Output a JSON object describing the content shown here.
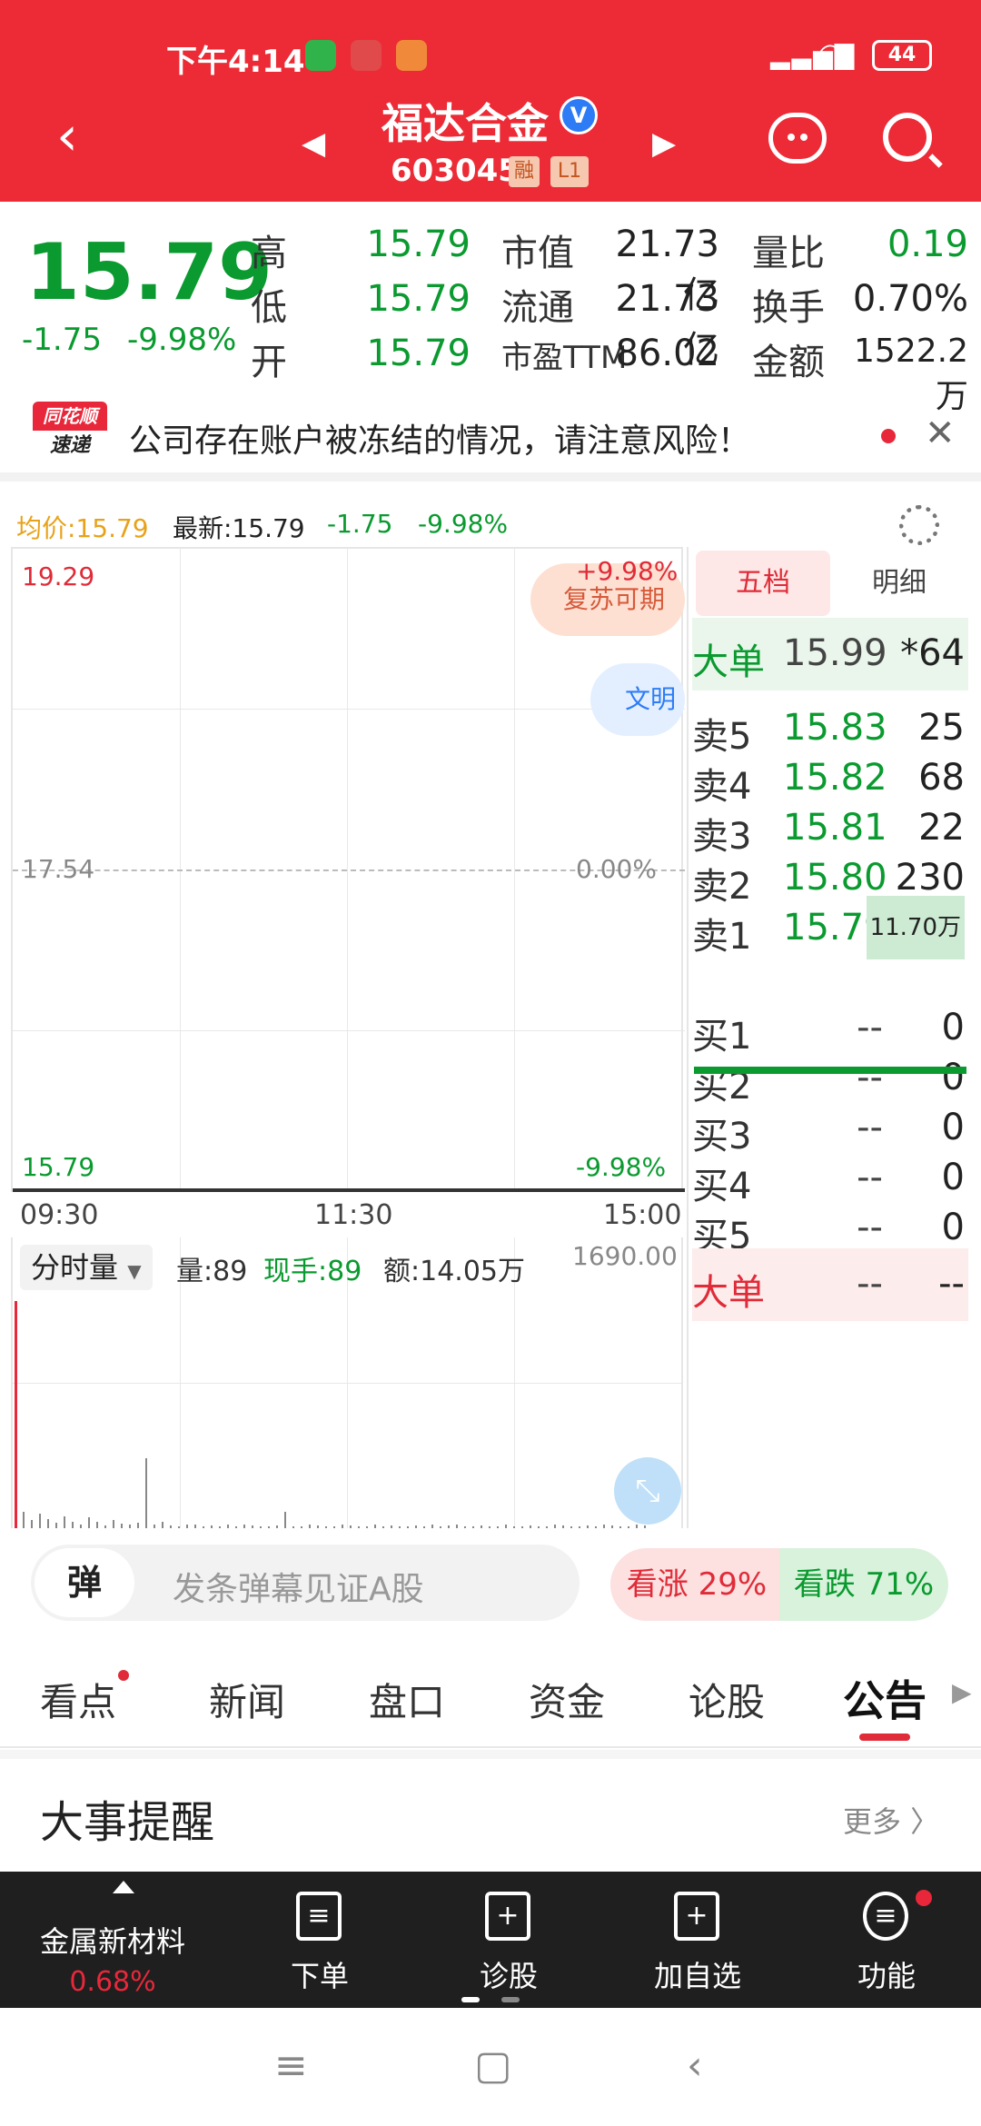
{
  "status_bar": {
    "time": "下午4:14",
    "battery": "44"
  },
  "header": {
    "stock_name": "福达合金",
    "stock_code": "603045",
    "tags": [
      "融",
      "L1"
    ]
  },
  "quote": {
    "price": "15.79",
    "change": "-1.75",
    "change_pct": "-9.98%",
    "rows": [
      {
        "l1": "高",
        "v1": "15.79",
        "l2": "市值",
        "v2": "21.73亿",
        "l3": "量比",
        "v3": "0.19"
      },
      {
        "l1": "低",
        "v1": "15.79",
        "l2": "流通",
        "v2": "21.73亿",
        "l3": "换手",
        "v3": "0.70%"
      },
      {
        "l1": "开",
        "v1": "15.79",
        "l2": "市盈TTM",
        "v2": "86.02",
        "l3": "金额",
        "v3": "1522.2万"
      }
    ]
  },
  "notice": {
    "logo_top": "同花顺",
    "logo_bottom": "速递",
    "text": "公司存在账户被冻结的情况，请注意风险！"
  },
  "chart_info": {
    "avg_price": "均价:15.79",
    "latest": "最新:15.79",
    "change": "-1.75",
    "change_pct": "-9.98%"
  },
  "intraday_chart": {
    "y_top": "19.29",
    "y_mid": "17.54",
    "y_bottom": "15.79",
    "pct_top": "+9.98%",
    "pct_mid": "0.00%",
    "pct_bottom": "-9.98%",
    "bubble_1": "复苏可期",
    "bubble_2": "文明",
    "time_labels": [
      "09:30",
      "11:30",
      "15:00"
    ]
  },
  "volume_panel": {
    "selector": "分时量",
    "vol": "量:89",
    "hand": "现手:89",
    "amount": "额:14.05万",
    "max": "1690.00",
    "bars": [
      1690,
      120,
      60,
      110,
      70,
      40,
      90,
      50,
      30,
      80,
      45,
      20,
      60,
      35,
      25,
      40,
      520,
      30,
      50,
      20,
      15,
      25,
      30,
      15,
      20,
      10,
      25,
      15,
      30,
      20,
      10,
      15,
      20,
      120,
      10,
      15,
      25,
      20,
      10,
      15,
      30,
      20,
      15,
      10,
      25,
      15,
      20,
      10,
      15,
      20,
      10,
      25,
      15,
      20,
      30,
      10,
      15,
      20,
      10,
      15,
      25,
      15,
      10,
      20,
      15,
      10,
      25,
      20,
      15,
      10,
      20,
      15,
      30,
      20,
      15,
      10,
      25,
      20
    ]
  },
  "order_book": {
    "tabs": [
      "五档",
      "明细"
    ],
    "big_sell": {
      "label": "大单",
      "price": "15.99",
      "vol": "*64"
    },
    "asks": [
      {
        "label": "卖5",
        "price": "15.83",
        "vol": "25"
      },
      {
        "label": "卖4",
        "price": "15.82",
        "vol": "68"
      },
      {
        "label": "卖3",
        "price": "15.81",
        "vol": "22"
      },
      {
        "label": "卖2",
        "price": "15.80",
        "vol": "230"
      },
      {
        "label": "卖1",
        "price": "15.79",
        "vol": "11.70万"
      }
    ],
    "bids": [
      {
        "label": "买1",
        "price": "--",
        "vol": "0"
      },
      {
        "label": "买2",
        "price": "--",
        "vol": "0"
      },
      {
        "label": "买3",
        "price": "--",
        "vol": "0"
      },
      {
        "label": "买4",
        "price": "--",
        "vol": "0"
      },
      {
        "label": "买5",
        "price": "--",
        "vol": "0"
      }
    ],
    "big_buy": {
      "label": "大单",
      "price": "--",
      "vol": "--"
    }
  },
  "danmu": {
    "icon": "弹",
    "placeholder": "发条弹幕见证A股"
  },
  "vote": {
    "up": "看涨 29%",
    "down": "看跌 71%"
  },
  "tabs": [
    "看点",
    "新闻",
    "盘口",
    "资金",
    "论股",
    "公告"
  ],
  "section": {
    "title": "大事提醒",
    "more": "更多 〉"
  },
  "bottom_bar": {
    "sector_name": "金属新材料",
    "sector_pct": "0.68%",
    "items": [
      "下单",
      "诊股",
      "加自选",
      "功能"
    ]
  },
  "colors": {
    "up": "#e02b38",
    "down": "#0a9a2f",
    "header": "#ec2b36"
  }
}
